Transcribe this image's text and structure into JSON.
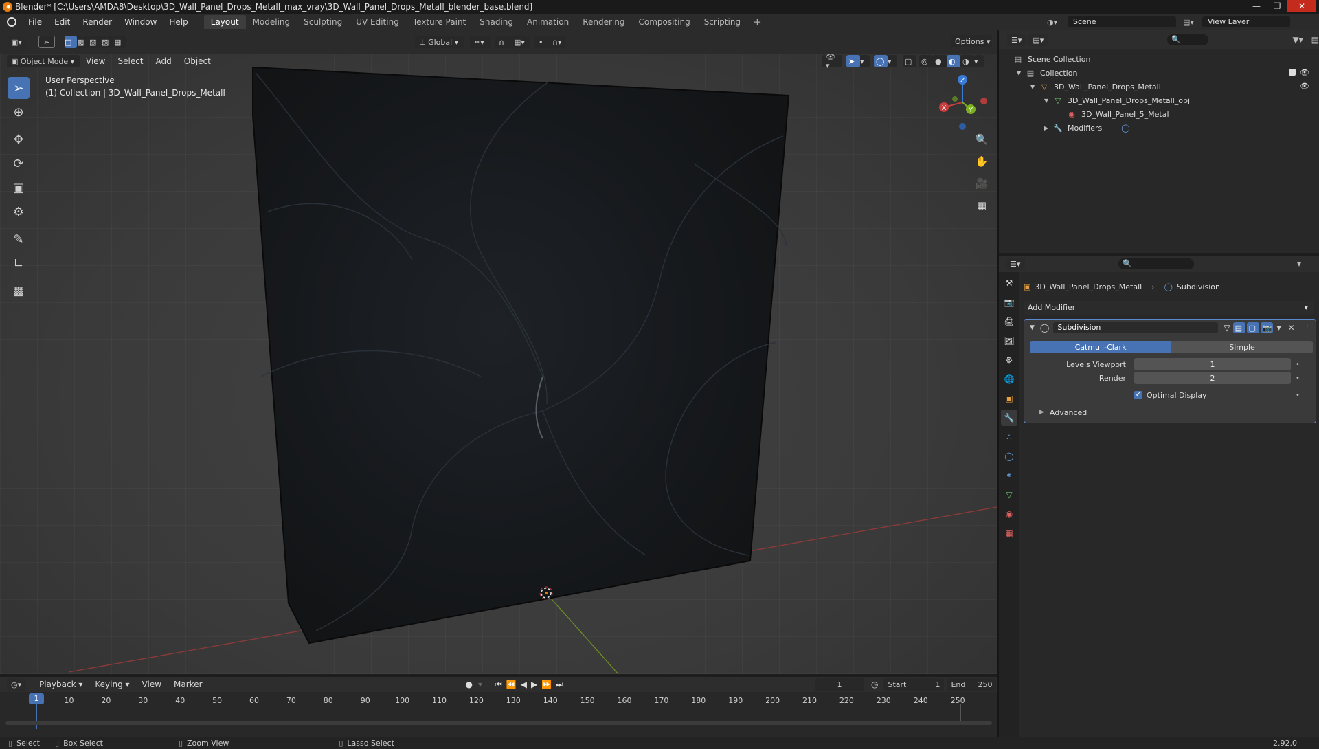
{
  "title_bar": {
    "text": "Blender* [C:\\Users\\AMDA8\\Desktop\\3D_Wall_Panel_Drops_Metall_max_vray\\3D_Wall_Panel_Drops_Metall_blender_base.blend]"
  },
  "menu": [
    "File",
    "Edit",
    "Render",
    "Window",
    "Help"
  ],
  "workspaces": [
    "Layout",
    "Modeling",
    "Sculpting",
    "UV Editing",
    "Texture Paint",
    "Shading",
    "Animation",
    "Rendering",
    "Compositing",
    "Scripting"
  ],
  "active_workspace": "Layout",
  "scene": "Scene",
  "view_layer": "View Layer",
  "viewport": {
    "transform_orientation": "Global",
    "options_label": "Options",
    "mode": "Object Mode",
    "menus": [
      "View",
      "Select",
      "Add",
      "Object"
    ],
    "overlay_title": "User Perspective",
    "overlay_subtitle": "(1) Collection | 3D_Wall_Panel_Drops_Metall",
    "gizmo_axes": {
      "x": "X",
      "y": "Y",
      "z": "Z"
    }
  },
  "outliner": {
    "root": "Scene Collection",
    "items": [
      {
        "label": "Collection"
      },
      {
        "label": "3D_Wall_Panel_Drops_Metall"
      },
      {
        "label": "3D_Wall_Panel_Drops_Metall_obj"
      },
      {
        "label": "3D_Wall_Panel_5_Metal"
      },
      {
        "label": "Modifiers"
      }
    ]
  },
  "properties": {
    "object_name": "3D_Wall_Panel_Drops_Metall",
    "modifier_crumb": "Subdivision",
    "add_modifier": "Add Modifier",
    "modifier": {
      "name": "Subdivision",
      "type_a": "Catmull-Clark",
      "type_b": "Simple",
      "levels_viewport_label": "Levels Viewport",
      "levels_viewport": "1",
      "render_label": "Render",
      "render": "2",
      "optimal_display": "Optimal Display",
      "advanced": "Advanced"
    }
  },
  "timeline": {
    "menus": [
      "Playback",
      "Keying",
      "View",
      "Marker"
    ],
    "current_frame": "1",
    "start_label": "Start",
    "start": "1",
    "end_label": "End",
    "end": "250",
    "ticks": [
      "1",
      "10",
      "20",
      "30",
      "40",
      "50",
      "60",
      "70",
      "80",
      "90",
      "100",
      "110",
      "120",
      "130",
      "140",
      "150",
      "160",
      "170",
      "180",
      "190",
      "200",
      "210",
      "220",
      "230",
      "240",
      "250"
    ]
  },
  "status": {
    "select": "Select",
    "box_select": "Box Select",
    "zoom_view": "Zoom View",
    "lasso_select": "Lasso Select",
    "version": "2.92.0"
  },
  "colors": {
    "accent": "#4772b3",
    "x_axis": "#c73c3c",
    "y_axis": "#7bb020",
    "z_axis": "#3c7bd6"
  }
}
